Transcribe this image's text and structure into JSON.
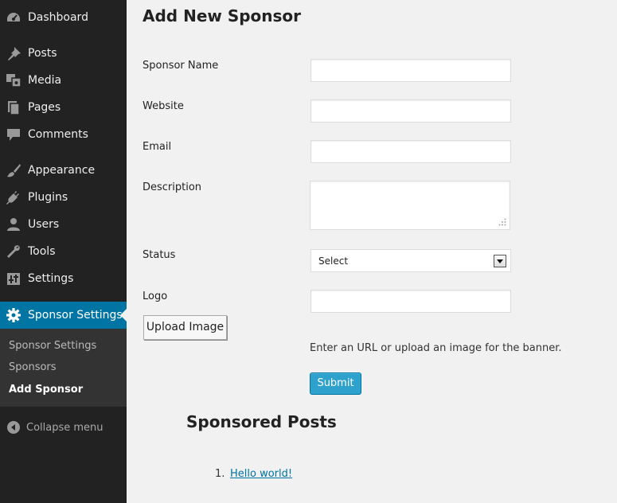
{
  "sidebar": {
    "items": [
      {
        "label": "Dashboard",
        "icon": "dashboard-icon"
      },
      {
        "label": "Posts",
        "icon": "pin-icon"
      },
      {
        "label": "Media",
        "icon": "media-icon"
      },
      {
        "label": "Pages",
        "icon": "pages-icon"
      },
      {
        "label": "Comments",
        "icon": "comment-icon"
      },
      {
        "label": "Appearance",
        "icon": "brush-icon"
      },
      {
        "label": "Plugins",
        "icon": "plug-icon"
      },
      {
        "label": "Users",
        "icon": "user-icon"
      },
      {
        "label": "Tools",
        "icon": "wrench-icon"
      },
      {
        "label": "Settings",
        "icon": "settings-sliders-icon"
      },
      {
        "label": "Sponsor Settings",
        "icon": "gear-icon",
        "current": true
      }
    ],
    "submenu": [
      {
        "label": "Sponsor Settings"
      },
      {
        "label": "Sponsors"
      },
      {
        "label": "Add Sponsor",
        "active": true
      }
    ],
    "collapse_label": "Collapse menu"
  },
  "form": {
    "title": "Add New Sponsor",
    "sponsor_name_label": "Sponsor Name",
    "sponsor_name_value": "",
    "website_label": "Website",
    "website_value": "",
    "email_label": "Email",
    "email_value": "",
    "description_label": "Description",
    "description_value": "",
    "status_label": "Status",
    "status_value": "Select",
    "logo_label": "Logo",
    "logo_value": "",
    "upload_label": "Upload Image",
    "help_text": "Enter an URL or upload an image for the banner.",
    "submit_label": "Submit"
  },
  "sponsored": {
    "title": "Sponsored Posts",
    "posts": [
      {
        "number": "1.",
        "title": "Hello world!"
      }
    ]
  },
  "colors": {
    "sidebar_bg": "#222222",
    "sidebar_current": "#0074a2",
    "submit_button": "#2ea2cc",
    "link": "#0074a2",
    "page_bg": "#f1f1f1"
  }
}
